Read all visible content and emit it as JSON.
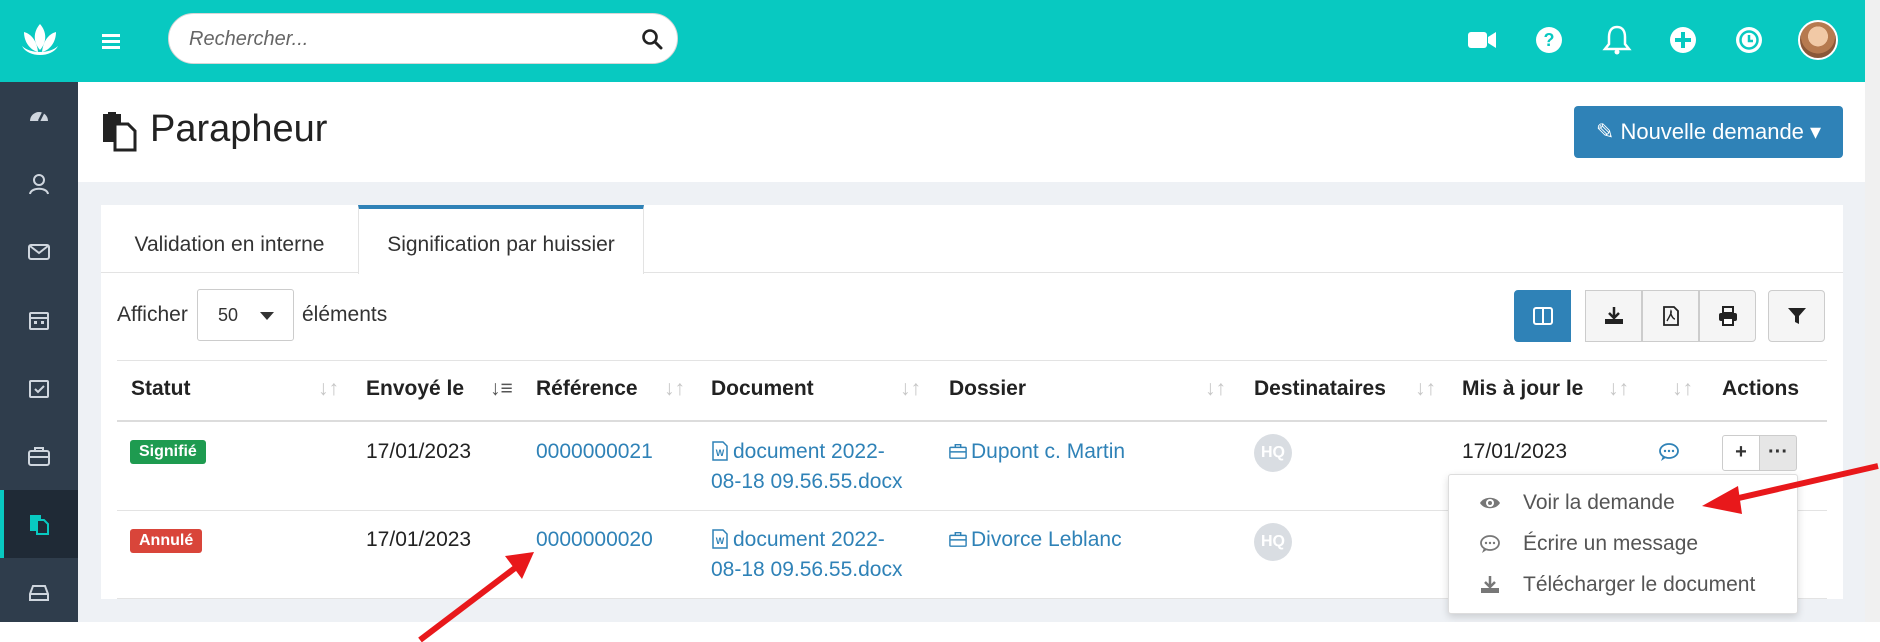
{
  "search": {
    "placeholder": "Rechercher..."
  },
  "topbar": {
    "icons": [
      "video-icon",
      "help-icon",
      "bell-icon",
      "plus-circle-icon",
      "clock-icon"
    ]
  },
  "sidebar": {
    "icons": [
      "dashboard-icon",
      "contacts-icon",
      "mail-icon",
      "calendar-icon",
      "tasks-icon",
      "briefcase-icon",
      "parapheur-icon",
      "archive-icon"
    ],
    "active": "parapheur-icon"
  },
  "page": {
    "title": "Parapheur",
    "new_button": "Nouvelle demande"
  },
  "tabs": [
    {
      "label": "Validation en interne"
    },
    {
      "label": "Signification par huissier"
    }
  ],
  "controls": {
    "show_prefix": "Afficher",
    "show_value": "50",
    "show_suffix": "éléments"
  },
  "toolbar": {
    "buttons": [
      "columns-icon",
      "download-icon",
      "pdf-icon",
      "print-icon",
      "filter-icon"
    ]
  },
  "table": {
    "headers": [
      "Statut",
      "Envoyé le",
      "Référence",
      "Document",
      "Dossier",
      "Destinataires",
      "Mis à jour le",
      "Actions"
    ],
    "rows": [
      {
        "status": "Signifié",
        "status_color": "#1e9b50",
        "sent": "17/01/2023",
        "reference": "0000000021",
        "doc_line1": "document 2022-",
        "doc_line2": "08-18 09.56.55.docx",
        "dossier": "Dupont c. Martin",
        "recipient": "HQ",
        "updated": "17/01/2023"
      },
      {
        "status": "Annulé",
        "status_color": "#d9453a",
        "sent": "17/01/2023",
        "reference": "0000000020",
        "doc_line1": "document 2022-",
        "doc_line2": "08-18 09.56.55.docx",
        "dossier": "Divorce Leblanc",
        "recipient": "HQ"
      }
    ]
  },
  "actions": {
    "plus": "+",
    "more": "···"
  },
  "menu": {
    "items": [
      "Voir la demande",
      "Écrire un message",
      "Télécharger le document"
    ]
  },
  "colors": {
    "topbar": "#08c9c1",
    "sidebar": "#2f3d4c",
    "primary": "#2f82b7",
    "annotation": "#e8181b"
  }
}
